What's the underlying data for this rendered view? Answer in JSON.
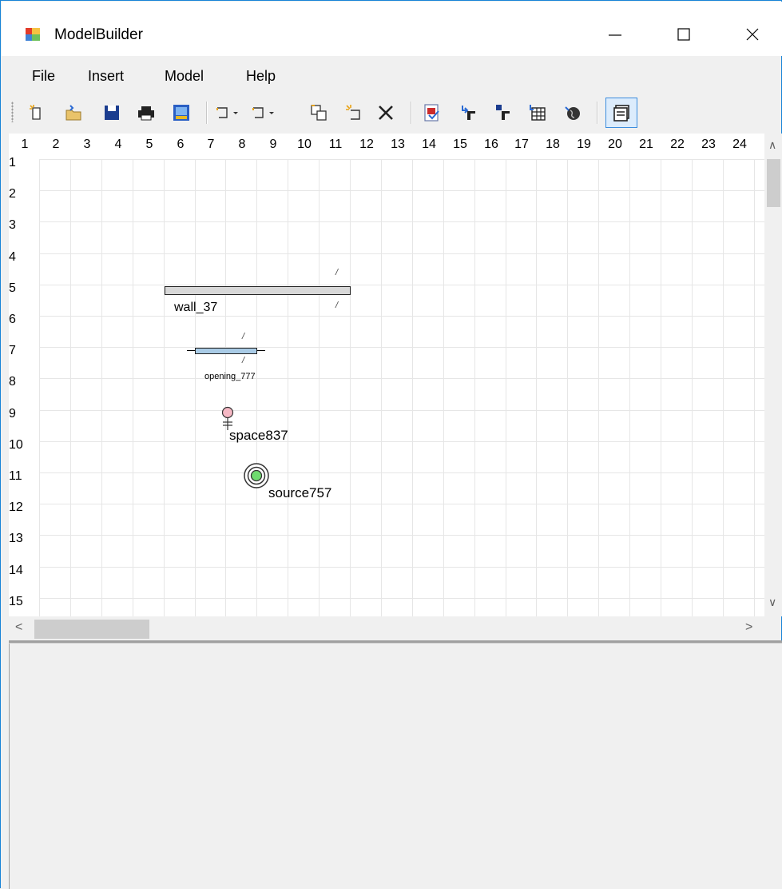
{
  "window": {
    "title": "ModelBuilder"
  },
  "menu": {
    "items": [
      "File",
      "Insert",
      "Model",
      "Help"
    ]
  },
  "toolbar": {
    "buttons": [
      "new-icon",
      "open-icon",
      "save-icon",
      "print-icon",
      "image-icon",
      "insert-dropdown-icon",
      "insert2-dropdown-icon",
      "copy-icon",
      "add-icon",
      "delete-icon",
      "check-icon",
      "export-icon",
      "import-icon",
      "table-icon",
      "globe-icon",
      "window-icon"
    ]
  },
  "grid": {
    "columns": [
      "1",
      "2",
      "3",
      "4",
      "5",
      "6",
      "7",
      "8",
      "9",
      "10",
      "11",
      "12",
      "13",
      "14",
      "15",
      "16",
      "17",
      "18",
      "19",
      "20",
      "21",
      "22",
      "23",
      "24"
    ],
    "rows": [
      "1",
      "2",
      "3",
      "4",
      "5",
      "6",
      "7",
      "8",
      "9",
      "10",
      "11",
      "12",
      "13",
      "14",
      "15"
    ]
  },
  "objects": {
    "wall": {
      "label": "wall_37",
      "tick_top": "/",
      "tick_bottom": "/"
    },
    "opening": {
      "label": "opening_777",
      "tick_top": "/",
      "tick_bottom": "/"
    },
    "space": {
      "label": "space837"
    },
    "source": {
      "label": "source757"
    }
  },
  "colors": {
    "accent": "#1883d7",
    "space_fill": "#f6b8c4",
    "source_fill": "#6fdc6f",
    "wall_fill": "#d8d8d8"
  }
}
